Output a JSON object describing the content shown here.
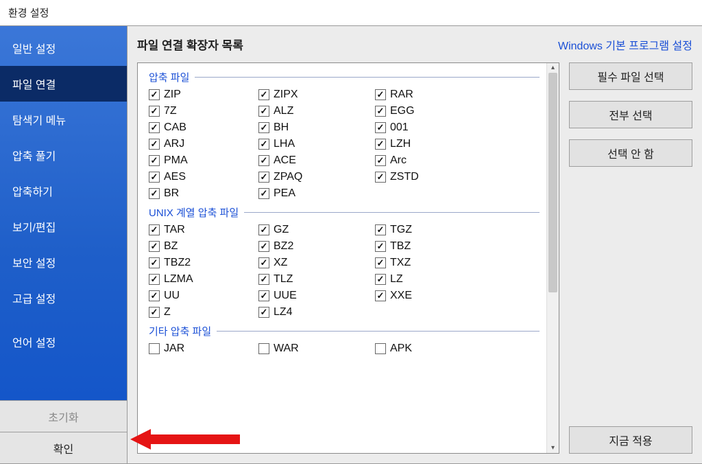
{
  "window": {
    "title": "환경 설정"
  },
  "sidebar": {
    "items": [
      {
        "label": "일반 설정"
      },
      {
        "label": "파일 연결",
        "selected": true
      },
      {
        "label": "탐색기 메뉴"
      },
      {
        "label": "압축 풀기"
      },
      {
        "label": "압축하기"
      },
      {
        "label": "보기/편집"
      },
      {
        "label": "보안 설정"
      },
      {
        "label": "고급 설정"
      }
    ],
    "itemsAfterSpacer": [
      {
        "label": "언어 설정"
      }
    ],
    "resetLabel": "초기화",
    "okLabel": "확인"
  },
  "content": {
    "title": "파일 연결 확장자 목록",
    "linkLabel": "Windows 기본 프로그램 설정"
  },
  "buttons": {
    "essential": "필수 파일 선택",
    "selectAll": "전부 선택",
    "selectNone": "선택 안 함",
    "applyNow": "지금 적용"
  },
  "groups": [
    {
      "title": "압축 파일",
      "items": [
        {
          "label": "ZIP",
          "checked": true
        },
        {
          "label": "ZIPX",
          "checked": true
        },
        {
          "label": "RAR",
          "checked": true
        },
        {
          "label": "7Z",
          "checked": true
        },
        {
          "label": "ALZ",
          "checked": true
        },
        {
          "label": "EGG",
          "checked": true
        },
        {
          "label": "CAB",
          "checked": true
        },
        {
          "label": "BH",
          "checked": true
        },
        {
          "label": "001",
          "checked": true
        },
        {
          "label": "ARJ",
          "checked": true
        },
        {
          "label": "LHA",
          "checked": true
        },
        {
          "label": "LZH",
          "checked": true
        },
        {
          "label": "PMA",
          "checked": true
        },
        {
          "label": "ACE",
          "checked": true
        },
        {
          "label": "Arc",
          "checked": true
        },
        {
          "label": "AES",
          "checked": true
        },
        {
          "label": "ZPAQ",
          "checked": true
        },
        {
          "label": "ZSTD",
          "checked": true
        },
        {
          "label": "BR",
          "checked": true
        },
        {
          "label": "PEA",
          "checked": true
        }
      ]
    },
    {
      "title": "UNIX 계열 압축 파일",
      "items": [
        {
          "label": "TAR",
          "checked": true
        },
        {
          "label": "GZ",
          "checked": true
        },
        {
          "label": "TGZ",
          "checked": true
        },
        {
          "label": "BZ",
          "checked": true
        },
        {
          "label": "BZ2",
          "checked": true
        },
        {
          "label": "TBZ",
          "checked": true
        },
        {
          "label": "TBZ2",
          "checked": true
        },
        {
          "label": "XZ",
          "checked": true
        },
        {
          "label": "TXZ",
          "checked": true
        },
        {
          "label": "LZMA",
          "checked": true
        },
        {
          "label": "TLZ",
          "checked": true
        },
        {
          "label": "LZ",
          "checked": true
        },
        {
          "label": "UU",
          "checked": true
        },
        {
          "label": "UUE",
          "checked": true
        },
        {
          "label": "XXE",
          "checked": true
        },
        {
          "label": "Z",
          "checked": true
        },
        {
          "label": "LZ4",
          "checked": true
        }
      ]
    },
    {
      "title": "기타 압축 파일",
      "items": [
        {
          "label": "JAR",
          "checked": false
        },
        {
          "label": "WAR",
          "checked": false
        },
        {
          "label": "APK",
          "checked": false
        }
      ]
    }
  ]
}
